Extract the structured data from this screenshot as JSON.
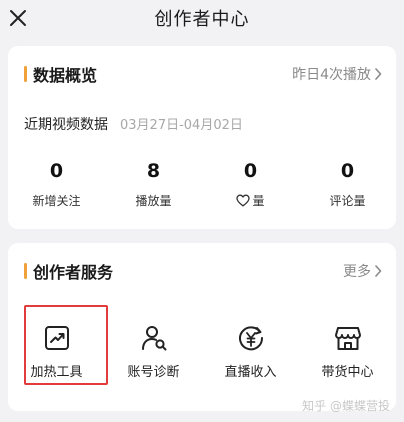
{
  "header": {
    "title": "创作者中心",
    "close_icon": "close-icon"
  },
  "overview": {
    "title": "数据概览",
    "link": "昨日4次播放",
    "recent_label": "近期视频数据",
    "recent_range": "03月27日-04月02日",
    "stats": [
      {
        "value": "0",
        "label": "新增关注"
      },
      {
        "value": "8",
        "label": "播放量"
      },
      {
        "value": "0",
        "label": "量",
        "icon": "heart-icon"
      },
      {
        "value": "0",
        "label": "评论量"
      }
    ]
  },
  "services": {
    "title": "创作者服务",
    "link": "更多",
    "items": [
      {
        "label": "加热工具",
        "icon": "trend-chart-icon"
      },
      {
        "label": "账号诊断",
        "icon": "user-search-icon"
      },
      {
        "label": "直播收入",
        "icon": "yuan-income-icon"
      },
      {
        "label": "带货中心",
        "icon": "shop-icon"
      }
    ]
  },
  "watermark": "知乎 @蝶蝶营投",
  "colors": {
    "accent": "#f0a13a",
    "highlight": "#e23b3b",
    "background": "#f2f2f4"
  }
}
